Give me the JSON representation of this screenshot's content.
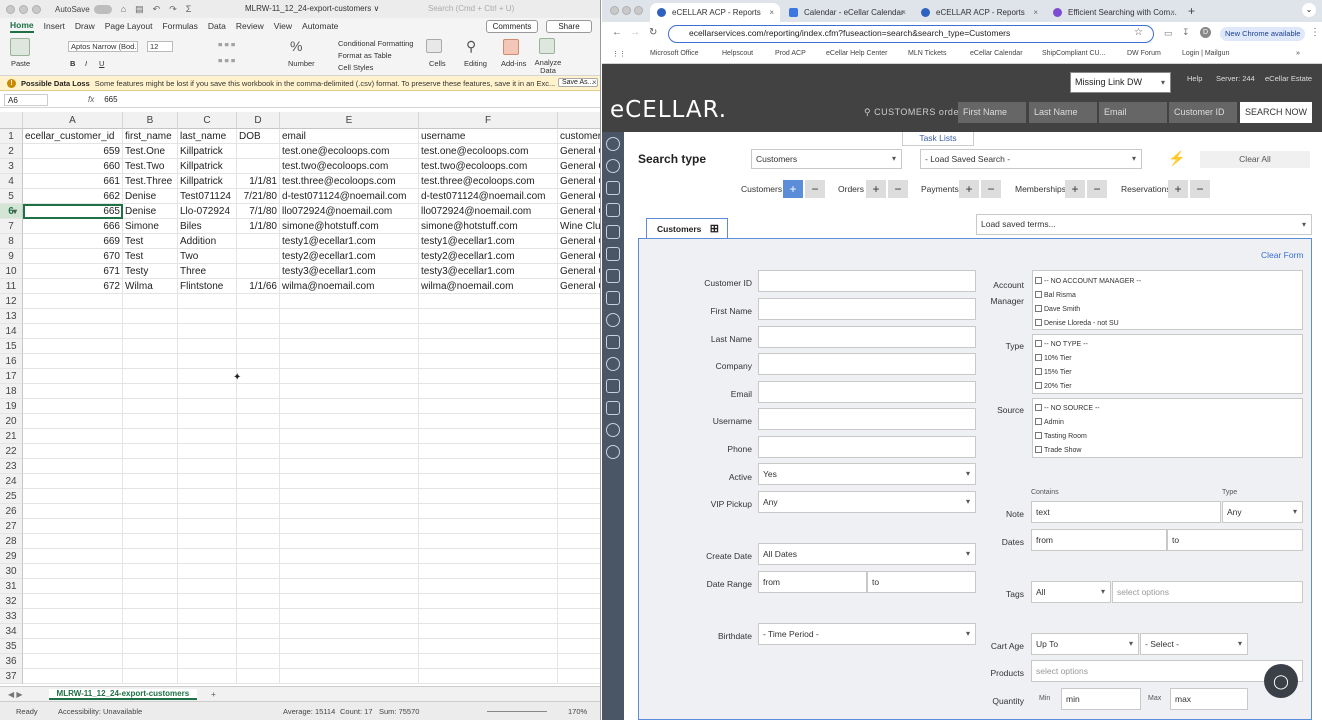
{
  "excel": {
    "autosave": "AutoSave",
    "filename": "MLRW-11_12_24-export-customers ∨",
    "search": "Search (Cmd + Ctrl + U)",
    "tabs": [
      "Home",
      "Insert",
      "Draw",
      "Page Layout",
      "Formulas",
      "Data",
      "Review",
      "View",
      "Automate"
    ],
    "comments": "Comments",
    "share": "Share",
    "ribbon": {
      "paste": "Paste",
      "font": "Aptos Narrow (Bod...",
      "size": "12",
      "cond": "Conditional Formatting",
      "table": "Format as Table",
      "styles": "Cell Styles",
      "number": "Number",
      "cells": "Cells",
      "editing": "Editing",
      "addins": "Add-ins",
      "analyze": "Analyze Data"
    },
    "warning": {
      "title": "Possible Data Loss",
      "msg": "Some features might be lost if you save this workbook in the comma-delimited (.csv) format. To preserve these features, save it in an Exc...",
      "saveas": "Save As...",
      "close": "×"
    },
    "namebox": "A6",
    "fx": "fx",
    "formula": "665",
    "cols": [
      "A",
      "B",
      "C",
      "D",
      "E",
      "F"
    ],
    "headers": [
      "ecellar_customer_id",
      "first_name",
      "last_name",
      "DOB",
      "email",
      "username",
      "customer"
    ],
    "rows": [
      [
        "659",
        "Test.One",
        "Killpatrick",
        "",
        "test.one@ecoloops.com",
        "test.one@ecoloops.com",
        "General C"
      ],
      [
        "660",
        "Test.Two",
        "Killpatrick",
        "",
        "test.two@ecoloops.com",
        "test.two@ecoloops.com",
        "General C"
      ],
      [
        "661",
        "Test.Three",
        "Killpatrick",
        "1/1/81",
        "test.three@ecoloops.com",
        "test.three@ecoloops.com",
        "General C"
      ],
      [
        "662",
        "Denise",
        "Test071124",
        "7/21/80",
        "d-test071124@noemail.com",
        "d-test071124@noemail.com",
        "General C"
      ],
      [
        "665",
        "Denise",
        "Llo-072924",
        "7/1/80",
        "llo072924@noemail.com",
        "llo072924@noemail.com",
        "General C"
      ],
      [
        "666",
        "Simone",
        "Biles",
        "1/1/80",
        "simone@hotstuff.com",
        "simone@hotstuff.com",
        "Wine Club"
      ],
      [
        "669",
        "Test",
        "Addition",
        "",
        "testy1@ecellar1.com",
        "testy1@ecellar1.com",
        "General C"
      ],
      [
        "670",
        "Test",
        "Two",
        "",
        "testy2@ecellar1.com",
        "testy2@ecellar1.com",
        "General C"
      ],
      [
        "671",
        "Testy",
        "Three",
        "",
        "testy3@ecellar1.com",
        "testy3@ecellar1.com",
        "General C"
      ],
      [
        "672",
        "Wilma",
        "Flintstone",
        "1/1/66",
        "wilma@noemail.com",
        "wilma@noemail.com",
        "General C"
      ]
    ],
    "row_numbers": [
      "1",
      "2",
      "3",
      "4",
      "5",
      "6",
      "7",
      "8",
      "9",
      "10",
      "11",
      "12",
      "13",
      "14",
      "15",
      "16",
      "17",
      "18",
      "19",
      "20",
      "21",
      "22",
      "23",
      "24",
      "25",
      "26",
      "27",
      "28",
      "29",
      "30",
      "31",
      "32",
      "33",
      "34",
      "35",
      "36",
      "37"
    ],
    "sheet_tab": "MLRW-11_12_24-export-customers",
    "status": {
      "ready": "Ready",
      "access": "Accessibility: Unavailable",
      "avg": "Average: 15114",
      "count": "Count: 17",
      "sum": "Sum: 75570",
      "zoom": "170%"
    }
  },
  "chrome": {
    "tabs": [
      "eCELLAR ACP - Reports",
      "Calendar - eCellar Calendar",
      "eCELLAR ACP - Reports",
      "Efficient Searching with Com..."
    ],
    "url": "ecellarservices.com/reporting/index.cfm?fuseaction=search&search_type=Customers",
    "new_chrome": "New Chrome available",
    "bookmarks": [
      "Microsoft Office",
      "Helpscout",
      "Prod ACP",
      "eCellar Help Center",
      "MLN Tickets",
      "eCellar Calendar",
      "ShipCompliant CU...",
      "DW Forum",
      "Login | Mailgun"
    ]
  },
  "ecellar": {
    "logo": "eCELLAR.",
    "winery": "Missing Link DW",
    "help": "Help",
    "server": "Server: 244",
    "estate": "eCellar Estate",
    "search_label": "CUSTOMERS orders",
    "first_name": "First Name",
    "last_name": "Last Name",
    "email": "Email",
    "customer_id": "Customer ID",
    "search_now": "SEARCH NOW",
    "task_lists": "Task Lists",
    "search_type": "Search type",
    "search_type_value": "Customers",
    "load_saved_search": "- Load Saved Search -",
    "clear_all": "Clear All",
    "filters": [
      "Customers",
      "Orders",
      "Payments",
      "Memberships",
      "Reservations"
    ],
    "customers_tab": "Customers",
    "load_saved_terms": "Load saved terms...",
    "clear_form": "Clear Form",
    "left_fields": {
      "customer_id": "Customer ID",
      "first_name": "First Name",
      "last_name": "Last Name",
      "company": "Company",
      "email": "Email",
      "username": "Username",
      "phone": "Phone",
      "active": "Active",
      "active_val": "Yes",
      "vip": "VIP Pickup",
      "vip_val": "Any",
      "create_date": "Create Date",
      "create_date_val": "All Dates",
      "date_range": "Date Range",
      "from": "from",
      "to": "to",
      "birthdate": "Birthdate",
      "birthdate_val": "- Time Period -"
    },
    "account_manager": "Account Manager",
    "am_options": [
      "-- NO ACCOUNT MANAGER --",
      "Bal Risma",
      "Dave Smith",
      "Denise Lloreda - not SU"
    ],
    "type": "Type",
    "type_options": [
      "-- NO TYPE --",
      "10% Tier",
      "15% Tier",
      "20% Tier"
    ],
    "source": "Source",
    "source_options": [
      "-- NO SOURCE --",
      "Admin",
      "Tasting Room",
      "Trade Show"
    ],
    "contains": "Contains",
    "type_small": "Type",
    "note": "Note",
    "note_val": "text",
    "note_type": "Any",
    "dates": "Dates",
    "from": "from",
    "to": "to",
    "tags": "Tags",
    "tags_val": "All",
    "select_options": "select options",
    "cart_age": "Cart Age",
    "upto": "Up To",
    "select": "- Select -",
    "products": "Products",
    "quantity": "Quantity",
    "min": "Min",
    "min_val": "min",
    "max": "Max",
    "max_val": "max"
  }
}
